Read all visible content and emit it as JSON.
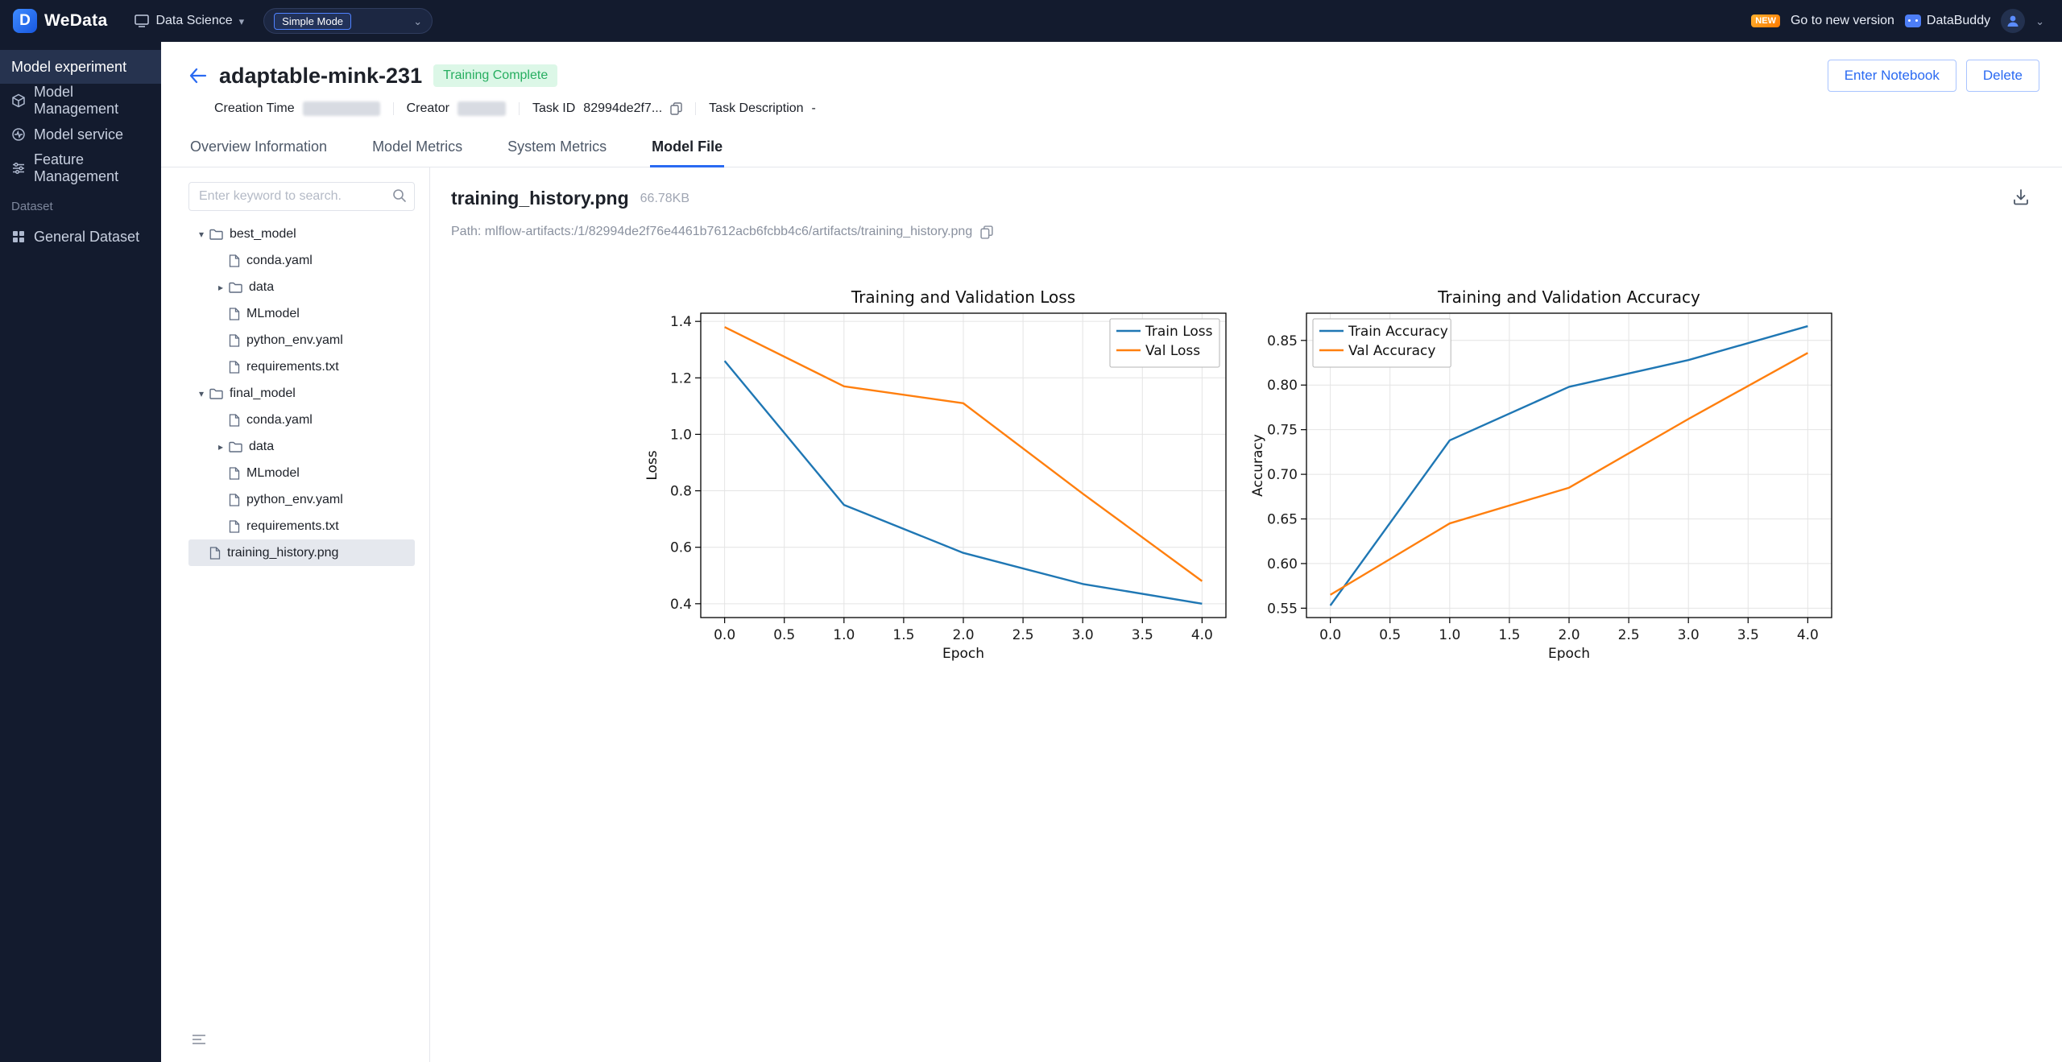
{
  "colors": {
    "accent": "#2a6af2",
    "status_success_bg": "#dcf7e7",
    "status_success_text": "#27ae60",
    "chart_blue": "#1f77b4",
    "chart_orange": "#ff7f0e"
  },
  "topbar": {
    "brand": "WeData",
    "workspace": "Data Science",
    "mode": "Simple Mode",
    "new_badge": "NEW",
    "new_version": "Go to new version",
    "assistant": "DataBuddy"
  },
  "sidebar": {
    "items": [
      {
        "label": "Model experiment",
        "active": true
      },
      {
        "label": "Model Management",
        "active": false
      },
      {
        "label": "Model service",
        "active": false
      },
      {
        "label": "Feature Management",
        "active": false
      }
    ],
    "section_label": "Dataset",
    "dataset_items": [
      {
        "label": "General Dataset"
      }
    ]
  },
  "header": {
    "title": "adaptable-mink-231",
    "status": "Training Complete",
    "meta": {
      "creation_time_label": "Creation Time",
      "creator_label": "Creator",
      "task_id_label": "Task ID",
      "task_id_value": "82994de2f7...",
      "task_description_label": "Task Description",
      "task_description_value": "-"
    },
    "actions": {
      "enter_notebook": "Enter Notebook",
      "delete": "Delete"
    }
  },
  "tabs": {
    "items": [
      {
        "label": "Overview Information",
        "active": false
      },
      {
        "label": "Model Metrics",
        "active": false
      },
      {
        "label": "System Metrics",
        "active": false
      },
      {
        "label": "Model File",
        "active": true
      }
    ]
  },
  "file_panel": {
    "search_placeholder": "Enter keyword to search.",
    "tree": [
      {
        "label": "best_model",
        "type": "folder",
        "depth": 0,
        "expanded": true,
        "selected": false
      },
      {
        "label": "conda.yaml",
        "type": "file",
        "depth": 1,
        "selected": false
      },
      {
        "label": "data",
        "type": "folder",
        "depth": 1,
        "expanded": false,
        "selected": false
      },
      {
        "label": "MLmodel",
        "type": "file",
        "depth": 1,
        "selected": false
      },
      {
        "label": "python_env.yaml",
        "type": "file",
        "depth": 1,
        "selected": false
      },
      {
        "label": "requirements.txt",
        "type": "file",
        "depth": 1,
        "selected": false
      },
      {
        "label": "final_model",
        "type": "folder",
        "depth": 0,
        "expanded": true,
        "selected": false
      },
      {
        "label": "conda.yaml",
        "type": "file",
        "depth": 1,
        "selected": false
      },
      {
        "label": "data",
        "type": "folder",
        "depth": 1,
        "expanded": false,
        "selected": false
      },
      {
        "label": "MLmodel",
        "type": "file",
        "depth": 1,
        "selected": false
      },
      {
        "label": "python_env.yaml",
        "type": "file",
        "depth": 1,
        "selected": false
      },
      {
        "label": "requirements.txt",
        "type": "file",
        "depth": 1,
        "selected": false
      },
      {
        "label": "training_history.png",
        "type": "file",
        "depth": 0,
        "selected": true
      }
    ]
  },
  "file_view": {
    "filename": "training_history.png",
    "filesize": "66.78KB",
    "path": "Path: mlflow-artifacts:/1/82994de2f76e4461b7612acb6fcbb4c6/artifacts/training_history.png"
  },
  "chart_data": [
    {
      "type": "line",
      "title": "Training and Validation Loss",
      "xlabel": "Epoch",
      "ylabel": "Loss",
      "x": [
        0,
        1,
        2,
        3,
        4
      ],
      "series": [
        {
          "name": "Train Loss",
          "color": "#1f77b4",
          "values": [
            1.26,
            0.75,
            0.58,
            0.47,
            0.4
          ]
        },
        {
          "name": "Val Loss",
          "color": "#ff7f0e",
          "values": [
            1.38,
            1.17,
            1.11,
            0.79,
            0.48
          ]
        }
      ],
      "xlim": [
        -0.2,
        4.2
      ],
      "ylim": [
        0.351,
        1.429
      ],
      "xtick_values": [
        0,
        0.5,
        1,
        1.5,
        2,
        2.5,
        3,
        3.5,
        4
      ],
      "xtick_labels": [
        "0.0",
        "0.5",
        "1.0",
        "1.5",
        "2.0",
        "2.5",
        "3.0",
        "3.5",
        "4.0"
      ],
      "ytick_values": [
        0.4,
        0.6,
        0.8,
        1.0,
        1.2,
        1.4
      ],
      "ytick_labels": [
        "0.4",
        "0.6",
        "0.8",
        "1.0",
        "1.2",
        "1.4"
      ],
      "grid": true,
      "legend_pos": "upper right"
    },
    {
      "type": "line",
      "title": "Training and Validation Accuracy",
      "xlabel": "Epoch",
      "ylabel": "Accuracy",
      "x": [
        0,
        1,
        2,
        3,
        4
      ],
      "series": [
        {
          "name": "Train Accuracy",
          "color": "#1f77b4",
          "values": [
            0.553,
            0.738,
            0.798,
            0.828,
            0.866
          ]
        },
        {
          "name": "Val Accuracy",
          "color": "#ff7f0e",
          "values": [
            0.565,
            0.645,
            0.685,
            0.762,
            0.836
          ]
        }
      ],
      "xlim": [
        -0.2,
        4.2
      ],
      "ylim": [
        0.5395,
        0.8805
      ],
      "xtick_values": [
        0,
        0.5,
        1,
        1.5,
        2,
        2.5,
        3,
        3.5,
        4
      ],
      "xtick_labels": [
        "0.0",
        "0.5",
        "1.0",
        "1.5",
        "2.0",
        "2.5",
        "3.0",
        "3.5",
        "4.0"
      ],
      "ytick_values": [
        0.55,
        0.6,
        0.65,
        0.7,
        0.75,
        0.8,
        0.85
      ],
      "ytick_labels": [
        "0.55",
        "0.60",
        "0.65",
        "0.70",
        "0.75",
        "0.80",
        "0.85"
      ],
      "grid": true,
      "legend_pos": "upper left"
    }
  ]
}
